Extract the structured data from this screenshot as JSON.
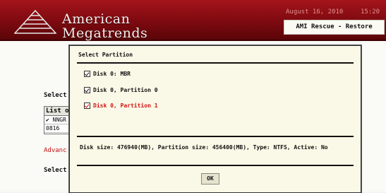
{
  "header": {
    "brand_line1": "American",
    "brand_line2": "Megatrends",
    "date": "August 16, 2010",
    "time": "15:20",
    "title": "AMI Rescue - Restore"
  },
  "background": {
    "select_label": "Select t",
    "list_header": "List of",
    "rows": [
      "✔ NNGR",
      "0816"
    ],
    "advanced_link": "Advanc",
    "select_label2": "Select"
  },
  "dialog": {
    "title": "Select Partition",
    "partitions": [
      {
        "label": "Disk 0: MBR",
        "checked": true,
        "selected": false
      },
      {
        "label": "Disk 0, Partition 0",
        "checked": true,
        "selected": false
      },
      {
        "label": "Disk 0, Partition 1",
        "checked": true,
        "selected": true
      }
    ],
    "info_text": "Disk size: 476940(MB), Partition size: 456400(MB), Type: NTFS, Active: No",
    "ok_label": "OK"
  },
  "colors": {
    "header": "#8e0d13",
    "dialog_bg": "#faf8e6",
    "selected_text": "#d21212"
  }
}
